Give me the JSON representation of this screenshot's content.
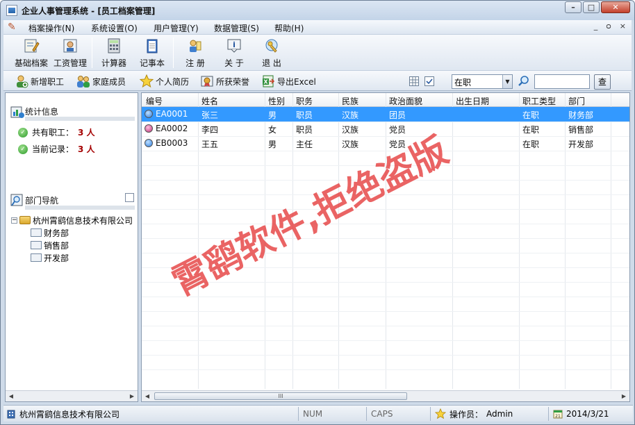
{
  "window": {
    "title": "企业人事管理系统 - [员工档案管理]",
    "buttons": {
      "minimize": "–",
      "maximize": "□",
      "close": "✕"
    }
  },
  "menu": {
    "items": [
      "档案操作(N)",
      "系统设置(O)",
      "用户管理(Y)",
      "数据管理(S)",
      "帮助(H)"
    ],
    "mdi": [
      "_",
      "ᴑ",
      "×"
    ]
  },
  "toolbar": {
    "items": [
      {
        "label": "基础档案",
        "icon": "record-icon"
      },
      {
        "label": "工资管理",
        "icon": "salary-icon"
      },
      {
        "label": "计算器",
        "icon": "calculator-icon"
      },
      {
        "label": "记事本",
        "icon": "notepad-icon"
      },
      {
        "label": "注 册",
        "icon": "register-icon"
      },
      {
        "label": "关 于",
        "icon": "about-icon"
      },
      {
        "label": "退 出",
        "icon": "exit-icon"
      }
    ]
  },
  "toolbar2": {
    "items": [
      {
        "label": "新增职工",
        "icon": "add-employee-icon"
      },
      {
        "label": "家庭成员",
        "icon": "family-icon"
      },
      {
        "label": "个人简历",
        "icon": "star-icon"
      },
      {
        "label": "所获荣誉",
        "icon": "honor-icon"
      },
      {
        "label": "导出Excel",
        "icon": "excel-icon"
      }
    ],
    "status_filter": "在职",
    "search_value": "",
    "query_label": "查"
  },
  "left_panel": {
    "stats_title": "统计信息",
    "total_label": "共有职工：",
    "total_value": "3 人",
    "current_label": "当前记录：",
    "current_value": "3 人",
    "dept_nav_title": "部门导航",
    "tree_root": "杭州霄鹞信息技术有限公司",
    "departments": [
      "财务部",
      "销售部",
      "开发部"
    ]
  },
  "grid": {
    "columns": [
      "编号",
      "姓名",
      "性别",
      "职务",
      "民族",
      "政治面貌",
      "出生日期",
      "职工类型",
      "部门"
    ],
    "rows": [
      [
        "EA0001",
        "张三",
        "男",
        "职员",
        "汉族",
        "团员",
        "",
        "在职",
        "财务部"
      ],
      [
        "EA0002",
        "李四",
        "女",
        "职员",
        "汉族",
        "党员",
        "",
        "在职",
        "销售部"
      ],
      [
        "EB0003",
        "王五",
        "男",
        "主任",
        "汉族",
        "党员",
        "",
        "在职",
        "开发部"
      ]
    ],
    "row_icon_colors": [
      "#2b7de0",
      "#c0307a",
      "#2b7de0"
    ],
    "scroll_marker": "III"
  },
  "watermark": "霄鹞软件,拒绝盗版",
  "statusbar": {
    "company": "杭州霄鹞信息技术有限公司",
    "num": "NUM",
    "caps": "CAPS",
    "operator_label": "操作员：",
    "operator": "Admin",
    "date": "2014/3/21"
  },
  "colors": {
    "selection": "#3399ff",
    "stat_value": "#a40000",
    "watermark": "#e22828"
  }
}
